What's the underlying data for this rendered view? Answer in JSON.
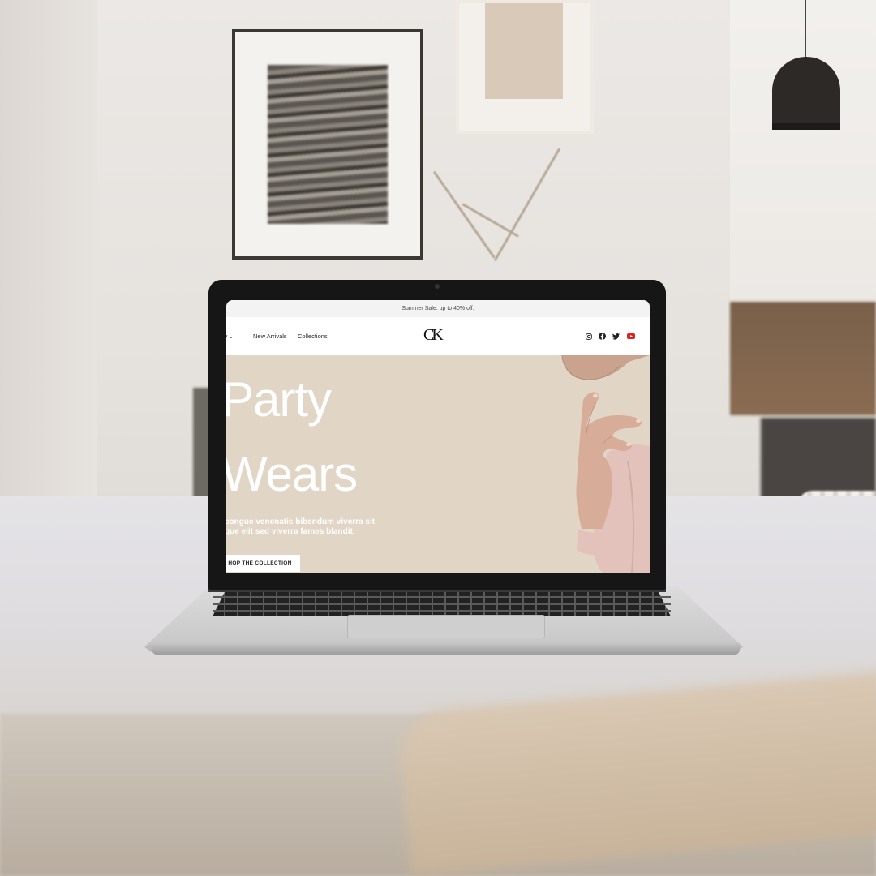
{
  "site": {
    "announcement": "Summer Sale. up to 40% off.",
    "nav": {
      "category_label": "ory",
      "new_arrivals": "New Arrivals",
      "collections": "Collections"
    },
    "logo": "CK",
    "social_icons": [
      "instagram-icon",
      "facebook-icon",
      "twitter-icon",
      "youtube-icon"
    ],
    "hero": {
      "title_line1": "Party",
      "title_line2": "Wears",
      "subtitle": "congue venenatis bibendum viverra sit\ngue elit sed viverra fames blandit.",
      "cta": "HOP THE COLLECTION"
    }
  },
  "colors": {
    "hero_bg": "#e1d5c6",
    "announce_bg": "#f3f3f3",
    "youtube_red": "#e02020",
    "text_dark": "#222222"
  }
}
